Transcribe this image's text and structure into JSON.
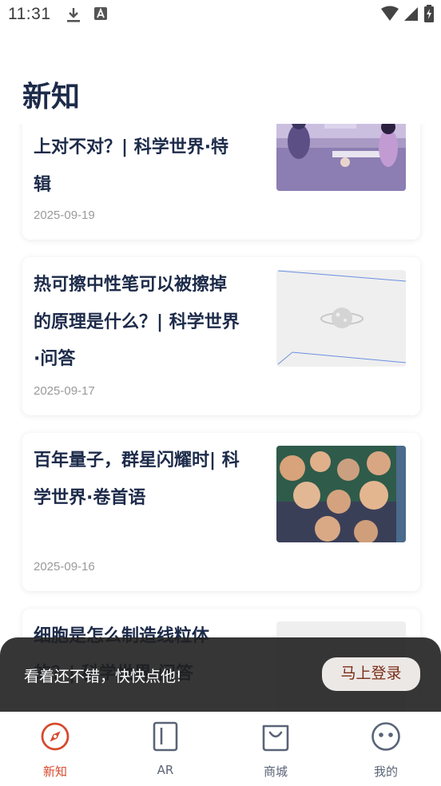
{
  "status_bar": {
    "time": "11:31"
  },
  "page_title": "新知",
  "articles": [
    {
      "title": "上对不对？| 科学世界·特辑",
      "date": "2025-09-19"
    },
    {
      "title": "热可擦中性笔可以被擦掉的原理是什么？| 科学世界·问答",
      "date": "2025-09-17"
    },
    {
      "title": "百年量子，群星闪耀时| 科学世界·卷首语",
      "date": "2025-09-16"
    },
    {
      "title": "细胞是怎么制造线粒体的？| 科学世界·问答",
      "date": ""
    }
  ],
  "toast": {
    "message": "看着还不错，快快点他!",
    "action_label": "马上登录"
  },
  "tabs": [
    {
      "label": "新知",
      "icon": "compass-icon",
      "active": true
    },
    {
      "label": "AR",
      "icon": "ar-icon",
      "active": false
    },
    {
      "label": "商城",
      "icon": "shopping-bag-icon",
      "active": false
    },
    {
      "label": "我的",
      "icon": "profile-face-icon",
      "active": false
    }
  ],
  "colors": {
    "accent": "#d7492c",
    "title_text": "#1d2b4a",
    "icon_gray": "#5a6478",
    "toast_bg": "#202020"
  }
}
